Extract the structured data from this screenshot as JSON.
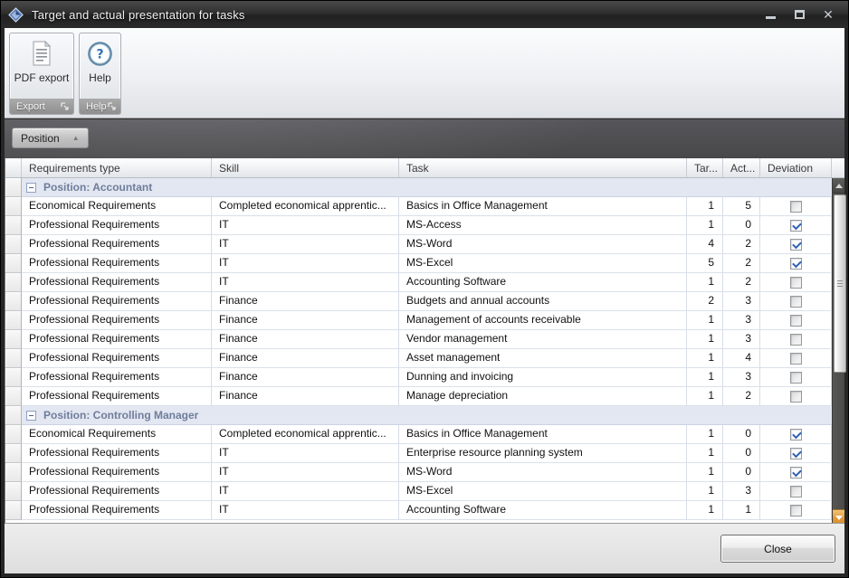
{
  "window": {
    "title": "Target and actual presentation for tasks"
  },
  "ribbon": {
    "groups": [
      {
        "button_label": "PDF export",
        "group_label": "Export"
      },
      {
        "button_label": "Help",
        "group_label": "Help"
      }
    ]
  },
  "group_panel": {
    "field_label": "Position",
    "sort_direction": "ascending"
  },
  "grid": {
    "columns": {
      "requirements_type": "Requirements type",
      "skill": "Skill",
      "task": "Task",
      "target": "Tar...",
      "actual": "Act...",
      "deviation": "Deviation"
    },
    "groups": [
      {
        "label": "Position: Accountant",
        "rows": [
          {
            "requirements_type": "Economical Requirements",
            "skill": "Completed economical apprentic...",
            "task": "Basics in Office Management",
            "target": 1,
            "actual": 5,
            "deviation": false
          },
          {
            "requirements_type": "Professional Requirements",
            "skill": "IT",
            "task": "MS-Access",
            "target": 1,
            "actual": 0,
            "deviation": true
          },
          {
            "requirements_type": "Professional Requirements",
            "skill": "IT",
            "task": "MS-Word",
            "target": 4,
            "actual": 2,
            "deviation": true
          },
          {
            "requirements_type": "Professional Requirements",
            "skill": "IT",
            "task": "MS-Excel",
            "target": 5,
            "actual": 2,
            "deviation": true
          },
          {
            "requirements_type": "Professional Requirements",
            "skill": "IT",
            "task": "Accounting Software",
            "target": 1,
            "actual": 2,
            "deviation": false
          },
          {
            "requirements_type": "Professional Requirements",
            "skill": "Finance",
            "task": "Budgets and annual accounts",
            "target": 2,
            "actual": 3,
            "deviation": false
          },
          {
            "requirements_type": "Professional Requirements",
            "skill": "Finance",
            "task": "Management of accounts receivable",
            "target": 1,
            "actual": 3,
            "deviation": false
          },
          {
            "requirements_type": "Professional Requirements",
            "skill": "Finance",
            "task": "Vendor management",
            "target": 1,
            "actual": 3,
            "deviation": false
          },
          {
            "requirements_type": "Professional Requirements",
            "skill": "Finance",
            "task": "Asset management",
            "target": 1,
            "actual": 4,
            "deviation": false
          },
          {
            "requirements_type": "Professional Requirements",
            "skill": "Finance",
            "task": "Dunning and invoicing",
            "target": 1,
            "actual": 3,
            "deviation": false
          },
          {
            "requirements_type": "Professional Requirements",
            "skill": "Finance",
            "task": "Manage depreciation",
            "target": 1,
            "actual": 2,
            "deviation": false
          }
        ]
      },
      {
        "label": "Position: Controlling Manager",
        "rows": [
          {
            "requirements_type": "Economical Requirements",
            "skill": "Completed economical apprentic...",
            "task": "Basics in Office Management",
            "target": 1,
            "actual": 0,
            "deviation": true
          },
          {
            "requirements_type": "Professional Requirements",
            "skill": "IT",
            "task": "Enterprise resource planning system",
            "target": 1,
            "actual": 0,
            "deviation": true
          },
          {
            "requirements_type": "Professional Requirements",
            "skill": "IT",
            "task": "MS-Word",
            "target": 1,
            "actual": 0,
            "deviation": true
          },
          {
            "requirements_type": "Professional Requirements",
            "skill": "IT",
            "task": "MS-Excel",
            "target": 1,
            "actual": 3,
            "deviation": false
          },
          {
            "requirements_type": "Professional Requirements",
            "skill": "IT",
            "task": "Accounting Software",
            "target": 1,
            "actual": 1,
            "deviation": false
          }
        ]
      }
    ]
  },
  "footer": {
    "close_label": "Close"
  },
  "icons": {
    "app": "diamond-icon",
    "pdf_export": "pdf-document-icon",
    "help": "question-mark-icon",
    "dialog_launcher": "dialog-launcher-icon",
    "sort": "sort-ascending-icon",
    "group_collapse": "collapse-minus-icon",
    "scroll_up": "triangle-up-icon",
    "scroll_down": "triangle-down-icon"
  },
  "colors": {
    "titlebar": "#2b2b2b",
    "group_band": "#4a4a48",
    "group_row_bg": "#e3e7f1",
    "group_row_text": "#6f7d9b",
    "cell_border": "#d7dde7",
    "check_blue": "#2f62b5",
    "scroll_hot_amber": "#e29a3a"
  }
}
